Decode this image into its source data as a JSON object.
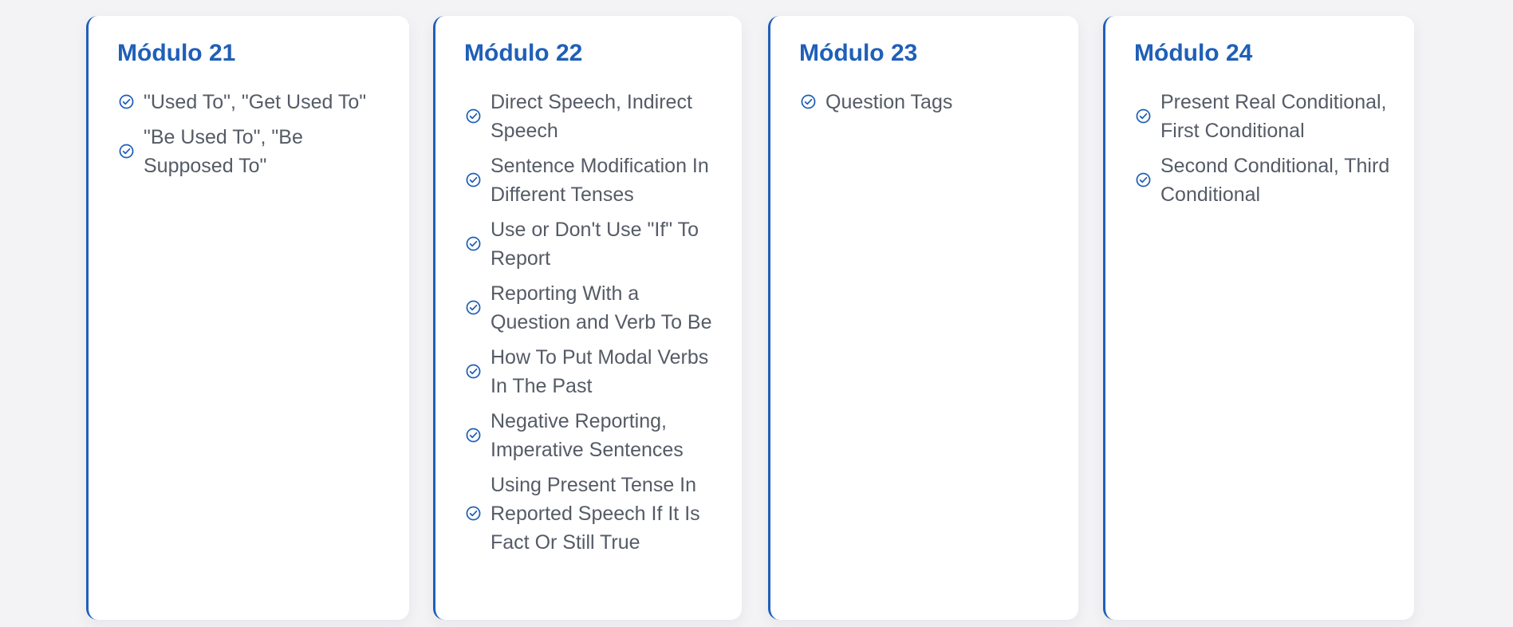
{
  "theme": {
    "accent_color": "#1f5fb8",
    "card_background": "#ffffff",
    "page_background": "#f3f3f5",
    "text_color": "#555b66"
  },
  "modules": [
    {
      "title": "Módulo 21",
      "icon": "check-circle-icon",
      "items": [
        "\"Used To\", \"Get Used To\"",
        "\"Be Used To\", \"Be Supposed To\""
      ]
    },
    {
      "title": "Módulo 22",
      "icon": "check-circle-icon",
      "items": [
        "Direct Speech, Indirect Speech",
        "Sentence Modification In Different Tenses",
        "Use or Don't Use \"If\" To Report",
        "Reporting With a Question and Verb To Be",
        "How To Put Modal Verbs In The Past",
        "Negative Reporting, Imperative Sentences",
        "Using Present Tense In Reported Speech If It Is Fact Or Still True"
      ]
    },
    {
      "title": "Módulo 23",
      "icon": "check-circle-icon",
      "items": [
        "Question Tags"
      ]
    },
    {
      "title": "Módulo 24",
      "icon": "check-circle-icon",
      "items": [
        "Present Real Conditional, First Conditional",
        "Second Conditional, Third Conditional"
      ]
    }
  ]
}
